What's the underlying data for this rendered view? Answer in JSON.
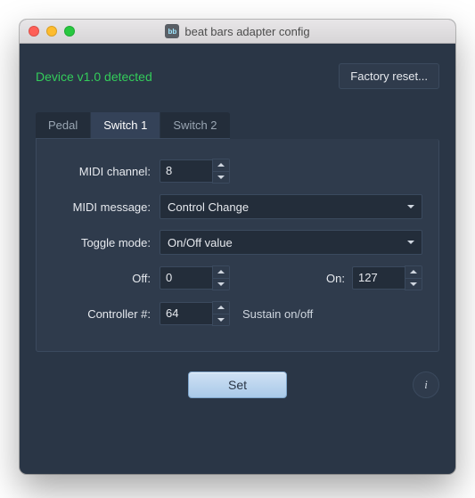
{
  "titlebar": {
    "title": "beat bars adapter config",
    "appIconText": "bb"
  },
  "status": {
    "text": "Device v1.0 detected"
  },
  "buttons": {
    "factoryReset": "Factory reset...",
    "set": "Set",
    "info": "i"
  },
  "tabs": [
    {
      "id": "pedal",
      "label": "Pedal",
      "active": false
    },
    {
      "id": "switch1",
      "label": "Switch 1",
      "active": true
    },
    {
      "id": "switch2",
      "label": "Switch 2",
      "active": false
    }
  ],
  "form": {
    "midiChannel": {
      "label": "MIDI channel:",
      "value": "8"
    },
    "midiMessage": {
      "label": "MIDI message:",
      "value": "Control Change"
    },
    "toggleMode": {
      "label": "Toggle mode:",
      "value": "On/Off value"
    },
    "off": {
      "label": "Off:",
      "value": "0"
    },
    "on": {
      "label": "On:",
      "value": "127"
    },
    "controllerNum": {
      "label": "Controller #:",
      "value": "64",
      "hint": "Sustain on/off"
    }
  }
}
